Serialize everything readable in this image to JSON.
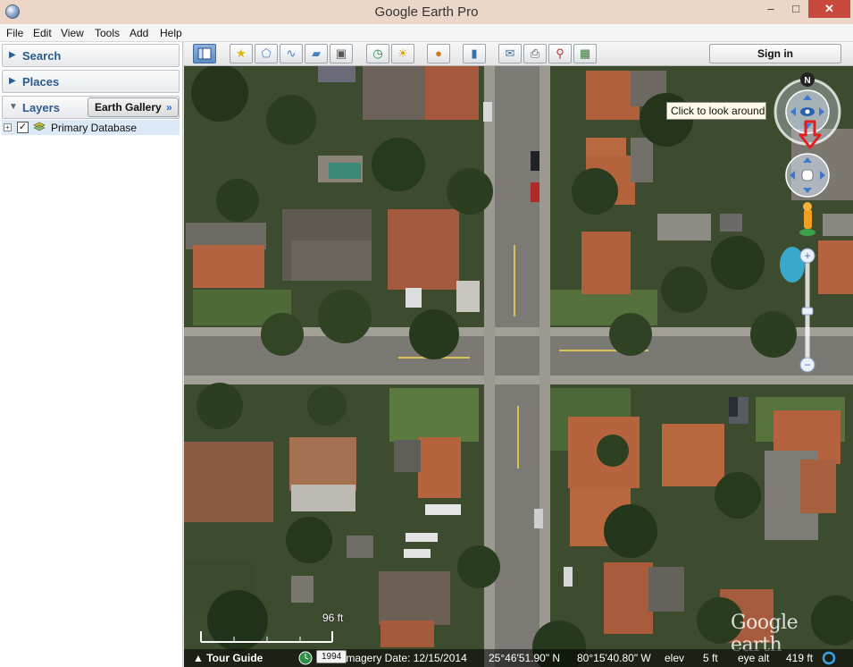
{
  "window": {
    "title": "Google Earth Pro",
    "min": "‒",
    "max": "□",
    "close": "✕"
  },
  "menu": [
    "File",
    "Edit",
    "View",
    "Tools",
    "Add",
    "Help"
  ],
  "sidebar": {
    "search": "Search",
    "places": "Places",
    "layers": "Layers",
    "gallery_button": "Earth Gallery",
    "gallery_chevron": "»",
    "database": {
      "label": "Primary Database",
      "checked": true
    }
  },
  "toolbar": {
    "buttons": [
      "hide-sidebar",
      "placemark",
      "polygon",
      "path",
      "image-overlay",
      "record-tour",
      "historical-imagery",
      "sunlight",
      "planets",
      "ruler",
      "email",
      "print",
      "view-in-maps",
      "save-image"
    ],
    "signin_label": "Sign in"
  },
  "navigation": {
    "north_label": "N",
    "tooltip": "Click to look around"
  },
  "map_overlay": {
    "scale_label": "96 ft",
    "logo": "Google earth"
  },
  "status": {
    "tour_guide": "Tour Guide",
    "year_badge": "1994",
    "imagery_date": "Imagery Date: 12/15/2014",
    "latitude": "25°46'51.90\" N",
    "longitude": "80°15'40.80\" W",
    "elev_label": "elev",
    "elev_value": "5 ft",
    "eye_alt_label": "eye alt",
    "eye_alt_value": "419 ft"
  },
  "colors": {
    "panel_text": "#2b5b8f",
    "close_button": "#c7483c",
    "highlight_arrow": "#e02020"
  }
}
